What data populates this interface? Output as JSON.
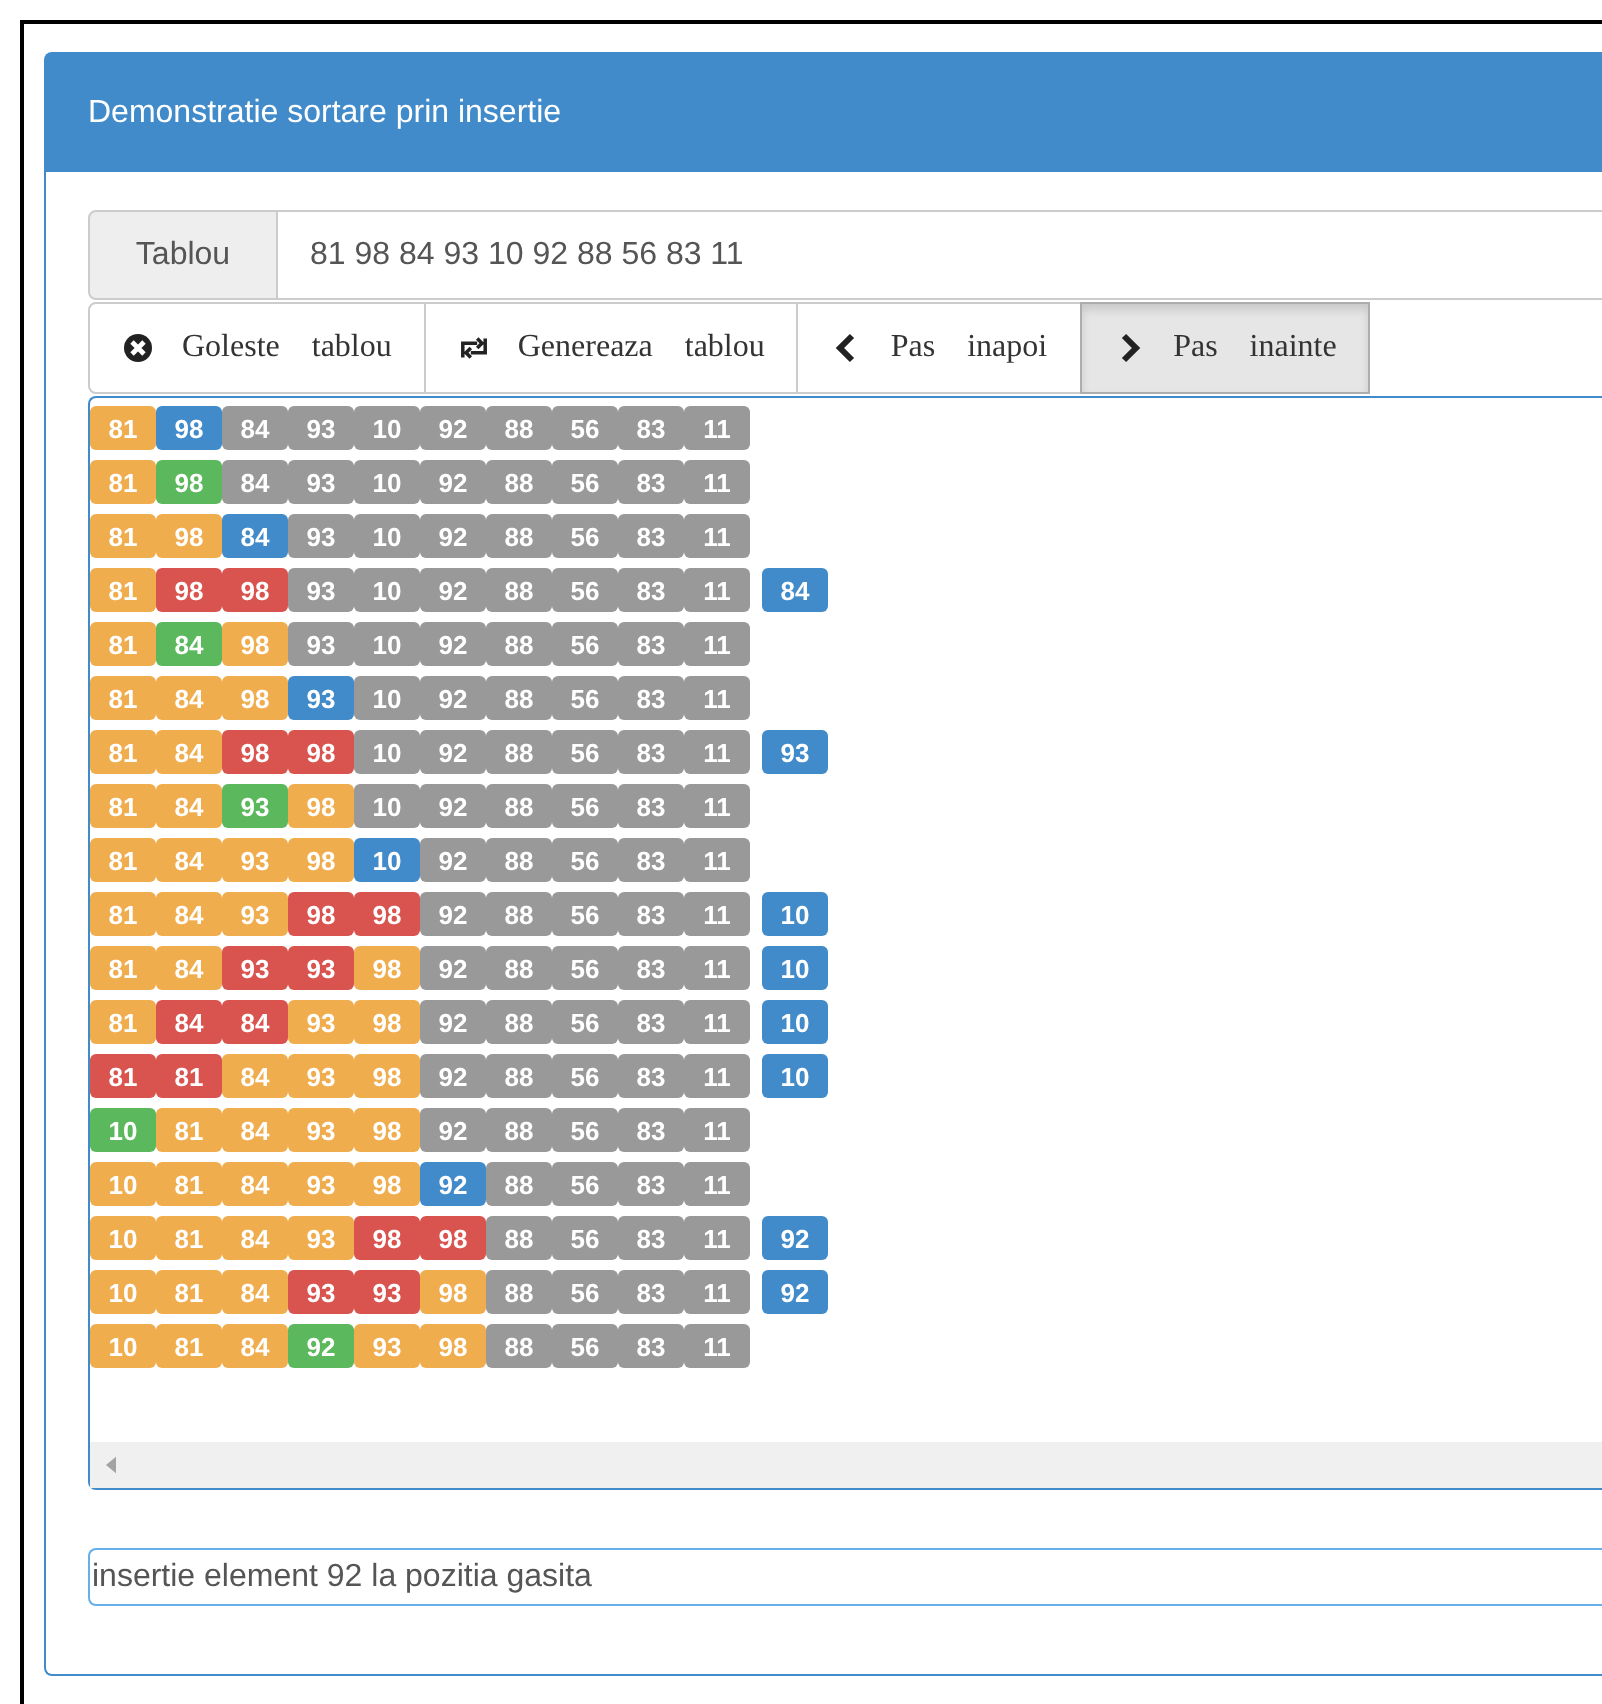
{
  "panel": {
    "title": "Demonstratie sortare prin insertie"
  },
  "array_input": {
    "label": "Tablou",
    "value": "81 98 84 93 10 92 88 56 83 11"
  },
  "buttons": [
    {
      "kind": "clear",
      "label": "Goleste tablou",
      "active": false
    },
    {
      "kind": "generate",
      "label": "Genereaza tablou",
      "active": false
    },
    {
      "kind": "back",
      "label": "Pas inapoi",
      "active": false
    },
    {
      "kind": "forward",
      "label": "Pas inainte",
      "active": true
    }
  ],
  "steps": [
    {
      "cells": [
        {
          "value": "81",
          "color": "#f0ad4e"
        },
        {
          "value": "98",
          "color": "#428bca"
        },
        {
          "value": "84",
          "color": "#999999"
        },
        {
          "value": "93",
          "color": "#999999"
        },
        {
          "value": "10",
          "color": "#999999"
        },
        {
          "value": "92",
          "color": "#999999"
        },
        {
          "value": "88",
          "color": "#999999"
        },
        {
          "value": "56",
          "color": "#999999"
        },
        {
          "value": "83",
          "color": "#999999"
        },
        {
          "value": "11",
          "color": "#999999"
        }
      ]
    },
    {
      "cells": [
        {
          "value": "81",
          "color": "#f0ad4e"
        },
        {
          "value": "98",
          "color": "#5cb85c"
        },
        {
          "value": "84",
          "color": "#999999"
        },
        {
          "value": "93",
          "color": "#999999"
        },
        {
          "value": "10",
          "color": "#999999"
        },
        {
          "value": "92",
          "color": "#999999"
        },
        {
          "value": "88",
          "color": "#999999"
        },
        {
          "value": "56",
          "color": "#999999"
        },
        {
          "value": "83",
          "color": "#999999"
        },
        {
          "value": "11",
          "color": "#999999"
        }
      ]
    },
    {
      "cells": [
        {
          "value": "81",
          "color": "#f0ad4e"
        },
        {
          "value": "98",
          "color": "#f0ad4e"
        },
        {
          "value": "84",
          "color": "#428bca"
        },
        {
          "value": "93",
          "color": "#999999"
        },
        {
          "value": "10",
          "color": "#999999"
        },
        {
          "value": "92",
          "color": "#999999"
        },
        {
          "value": "88",
          "color": "#999999"
        },
        {
          "value": "56",
          "color": "#999999"
        },
        {
          "value": "83",
          "color": "#999999"
        },
        {
          "value": "11",
          "color": "#999999"
        }
      ]
    },
    {
      "cells": [
        {
          "value": "81",
          "color": "#f0ad4e"
        },
        {
          "value": "98",
          "color": "#d9534f"
        },
        {
          "value": "98",
          "color": "#d9534f"
        },
        {
          "value": "93",
          "color": "#999999"
        },
        {
          "value": "10",
          "color": "#999999"
        },
        {
          "value": "92",
          "color": "#999999"
        },
        {
          "value": "88",
          "color": "#999999"
        },
        {
          "value": "56",
          "color": "#999999"
        },
        {
          "value": "83",
          "color": "#999999"
        },
        {
          "value": "11",
          "color": "#999999"
        }
      ],
      "key": "84"
    },
    {
      "cells": [
        {
          "value": "81",
          "color": "#f0ad4e"
        },
        {
          "value": "84",
          "color": "#5cb85c"
        },
        {
          "value": "98",
          "color": "#f0ad4e"
        },
        {
          "value": "93",
          "color": "#999999"
        },
        {
          "value": "10",
          "color": "#999999"
        },
        {
          "value": "92",
          "color": "#999999"
        },
        {
          "value": "88",
          "color": "#999999"
        },
        {
          "value": "56",
          "color": "#999999"
        },
        {
          "value": "83",
          "color": "#999999"
        },
        {
          "value": "11",
          "color": "#999999"
        }
      ]
    },
    {
      "cells": [
        {
          "value": "81",
          "color": "#f0ad4e"
        },
        {
          "value": "84",
          "color": "#f0ad4e"
        },
        {
          "value": "98",
          "color": "#f0ad4e"
        },
        {
          "value": "93",
          "color": "#428bca"
        },
        {
          "value": "10",
          "color": "#999999"
        },
        {
          "value": "92",
          "color": "#999999"
        },
        {
          "value": "88",
          "color": "#999999"
        },
        {
          "value": "56",
          "color": "#999999"
        },
        {
          "value": "83",
          "color": "#999999"
        },
        {
          "value": "11",
          "color": "#999999"
        }
      ]
    },
    {
      "cells": [
        {
          "value": "81",
          "color": "#f0ad4e"
        },
        {
          "value": "84",
          "color": "#f0ad4e"
        },
        {
          "value": "98",
          "color": "#d9534f"
        },
        {
          "value": "98",
          "color": "#d9534f"
        },
        {
          "value": "10",
          "color": "#999999"
        },
        {
          "value": "92",
          "color": "#999999"
        },
        {
          "value": "88",
          "color": "#999999"
        },
        {
          "value": "56",
          "color": "#999999"
        },
        {
          "value": "83",
          "color": "#999999"
        },
        {
          "value": "11",
          "color": "#999999"
        }
      ],
      "key": "93"
    },
    {
      "cells": [
        {
          "value": "81",
          "color": "#f0ad4e"
        },
        {
          "value": "84",
          "color": "#f0ad4e"
        },
        {
          "value": "93",
          "color": "#5cb85c"
        },
        {
          "value": "98",
          "color": "#f0ad4e"
        },
        {
          "value": "10",
          "color": "#999999"
        },
        {
          "value": "92",
          "color": "#999999"
        },
        {
          "value": "88",
          "color": "#999999"
        },
        {
          "value": "56",
          "color": "#999999"
        },
        {
          "value": "83",
          "color": "#999999"
        },
        {
          "value": "11",
          "color": "#999999"
        }
      ]
    },
    {
      "cells": [
        {
          "value": "81",
          "color": "#f0ad4e"
        },
        {
          "value": "84",
          "color": "#f0ad4e"
        },
        {
          "value": "93",
          "color": "#f0ad4e"
        },
        {
          "value": "98",
          "color": "#f0ad4e"
        },
        {
          "value": "10",
          "color": "#428bca"
        },
        {
          "value": "92",
          "color": "#999999"
        },
        {
          "value": "88",
          "color": "#999999"
        },
        {
          "value": "56",
          "color": "#999999"
        },
        {
          "value": "83",
          "color": "#999999"
        },
        {
          "value": "11",
          "color": "#999999"
        }
      ]
    },
    {
      "cells": [
        {
          "value": "81",
          "color": "#f0ad4e"
        },
        {
          "value": "84",
          "color": "#f0ad4e"
        },
        {
          "value": "93",
          "color": "#f0ad4e"
        },
        {
          "value": "98",
          "color": "#d9534f"
        },
        {
          "value": "98",
          "color": "#d9534f"
        },
        {
          "value": "92",
          "color": "#999999"
        },
        {
          "value": "88",
          "color": "#999999"
        },
        {
          "value": "56",
          "color": "#999999"
        },
        {
          "value": "83",
          "color": "#999999"
        },
        {
          "value": "11",
          "color": "#999999"
        }
      ],
      "key": "10"
    },
    {
      "cells": [
        {
          "value": "81",
          "color": "#f0ad4e"
        },
        {
          "value": "84",
          "color": "#f0ad4e"
        },
        {
          "value": "93",
          "color": "#d9534f"
        },
        {
          "value": "93",
          "color": "#d9534f"
        },
        {
          "value": "98",
          "color": "#f0ad4e"
        },
        {
          "value": "92",
          "color": "#999999"
        },
        {
          "value": "88",
          "color": "#999999"
        },
        {
          "value": "56",
          "color": "#999999"
        },
        {
          "value": "83",
          "color": "#999999"
        },
        {
          "value": "11",
          "color": "#999999"
        }
      ],
      "key": "10"
    },
    {
      "cells": [
        {
          "value": "81",
          "color": "#f0ad4e"
        },
        {
          "value": "84",
          "color": "#d9534f"
        },
        {
          "value": "84",
          "color": "#d9534f"
        },
        {
          "value": "93",
          "color": "#f0ad4e"
        },
        {
          "value": "98",
          "color": "#f0ad4e"
        },
        {
          "value": "92",
          "color": "#999999"
        },
        {
          "value": "88",
          "color": "#999999"
        },
        {
          "value": "56",
          "color": "#999999"
        },
        {
          "value": "83",
          "color": "#999999"
        },
        {
          "value": "11",
          "color": "#999999"
        }
      ],
      "key": "10"
    },
    {
      "cells": [
        {
          "value": "81",
          "color": "#d9534f"
        },
        {
          "value": "81",
          "color": "#d9534f"
        },
        {
          "value": "84",
          "color": "#f0ad4e"
        },
        {
          "value": "93",
          "color": "#f0ad4e"
        },
        {
          "value": "98",
          "color": "#f0ad4e"
        },
        {
          "value": "92",
          "color": "#999999"
        },
        {
          "value": "88",
          "color": "#999999"
        },
        {
          "value": "56",
          "color": "#999999"
        },
        {
          "value": "83",
          "color": "#999999"
        },
        {
          "value": "11",
          "color": "#999999"
        }
      ],
      "key": "10"
    },
    {
      "cells": [
        {
          "value": "10",
          "color": "#5cb85c"
        },
        {
          "value": "81",
          "color": "#f0ad4e"
        },
        {
          "value": "84",
          "color": "#f0ad4e"
        },
        {
          "value": "93",
          "color": "#f0ad4e"
        },
        {
          "value": "98",
          "color": "#f0ad4e"
        },
        {
          "value": "92",
          "color": "#999999"
        },
        {
          "value": "88",
          "color": "#999999"
        },
        {
          "value": "56",
          "color": "#999999"
        },
        {
          "value": "83",
          "color": "#999999"
        },
        {
          "value": "11",
          "color": "#999999"
        }
      ]
    },
    {
      "cells": [
        {
          "value": "10",
          "color": "#f0ad4e"
        },
        {
          "value": "81",
          "color": "#f0ad4e"
        },
        {
          "value": "84",
          "color": "#f0ad4e"
        },
        {
          "value": "93",
          "color": "#f0ad4e"
        },
        {
          "value": "98",
          "color": "#f0ad4e"
        },
        {
          "value": "92",
          "color": "#428bca"
        },
        {
          "value": "88",
          "color": "#999999"
        },
        {
          "value": "56",
          "color": "#999999"
        },
        {
          "value": "83",
          "color": "#999999"
        },
        {
          "value": "11",
          "color": "#999999"
        }
      ]
    },
    {
      "cells": [
        {
          "value": "10",
          "color": "#f0ad4e"
        },
        {
          "value": "81",
          "color": "#f0ad4e"
        },
        {
          "value": "84",
          "color": "#f0ad4e"
        },
        {
          "value": "93",
          "color": "#f0ad4e"
        },
        {
          "value": "98",
          "color": "#d9534f"
        },
        {
          "value": "98",
          "color": "#d9534f"
        },
        {
          "value": "88",
          "color": "#999999"
        },
        {
          "value": "56",
          "color": "#999999"
        },
        {
          "value": "83",
          "color": "#999999"
        },
        {
          "value": "11",
          "color": "#999999"
        }
      ],
      "key": "92"
    },
    {
      "cells": [
        {
          "value": "10",
          "color": "#f0ad4e"
        },
        {
          "value": "81",
          "color": "#f0ad4e"
        },
        {
          "value": "84",
          "color": "#f0ad4e"
        },
        {
          "value": "93",
          "color": "#d9534f"
        },
        {
          "value": "93",
          "color": "#d9534f"
        },
        {
          "value": "98",
          "color": "#f0ad4e"
        },
        {
          "value": "88",
          "color": "#999999"
        },
        {
          "value": "56",
          "color": "#999999"
        },
        {
          "value": "83",
          "color": "#999999"
        },
        {
          "value": "11",
          "color": "#999999"
        }
      ],
      "key": "92"
    },
    {
      "cells": [
        {
          "value": "10",
          "color": "#f0ad4e"
        },
        {
          "value": "81",
          "color": "#f0ad4e"
        },
        {
          "value": "84",
          "color": "#f0ad4e"
        },
        {
          "value": "92",
          "color": "#5cb85c"
        },
        {
          "value": "93",
          "color": "#f0ad4e"
        },
        {
          "value": "98",
          "color": "#f0ad4e"
        },
        {
          "value": "88",
          "color": "#999999"
        },
        {
          "value": "56",
          "color": "#999999"
        },
        {
          "value": "83",
          "color": "#999999"
        },
        {
          "value": "11",
          "color": "#999999"
        }
      ]
    }
  ],
  "status": {
    "value": "insertie element 92 la pozitia gasita"
  }
}
